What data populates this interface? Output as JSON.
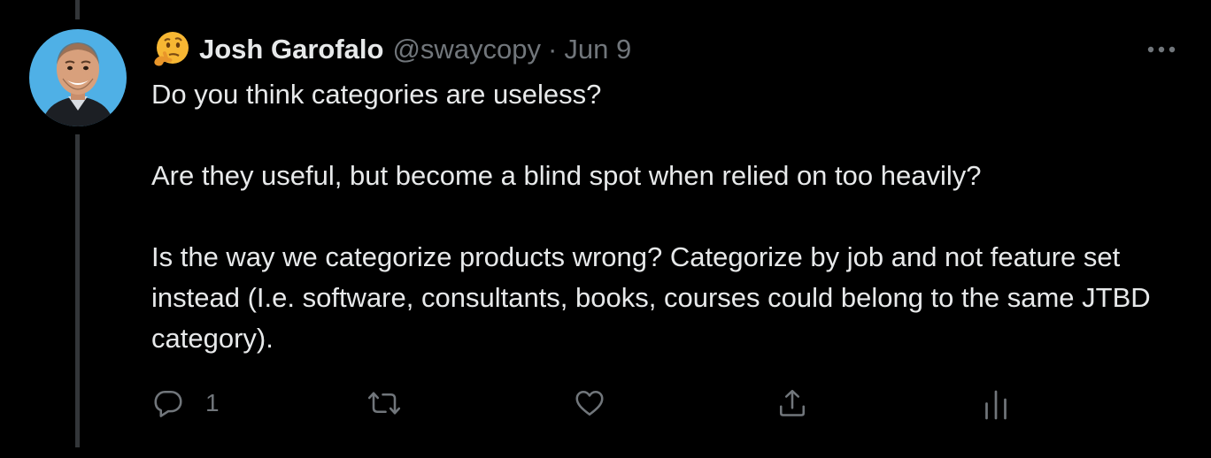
{
  "tweet": {
    "author": {
      "name": "Josh Garofalo",
      "handle": "@swaycopy",
      "emoji": "thinking-face-emoji",
      "avatar": "profile-photo"
    },
    "separator": "·",
    "date": "Jun 9",
    "paragraphs": [
      "Do you think categories are useless?",
      "Are they useful, but become a blind spot when relied on too heavily?",
      "Is the way we categorize products wrong? Categorize by job and not feature set instead (I.e. software, consultants, books, courses could belong to the same JTBD category)."
    ]
  },
  "actions": {
    "reply": {
      "icon": "reply-icon",
      "count": "1"
    },
    "retweet": {
      "icon": "retweet-icon"
    },
    "like": {
      "icon": "heart-icon"
    },
    "share": {
      "icon": "share-icon"
    },
    "analytics": {
      "icon": "analytics-icon"
    }
  },
  "menu": {
    "icon": "more-icon"
  },
  "colors": {
    "background": "#000000",
    "text": "#e7e9ea",
    "secondary": "#71767b",
    "thread_line": "#333639",
    "avatar_bg": "#4fb0e6"
  }
}
